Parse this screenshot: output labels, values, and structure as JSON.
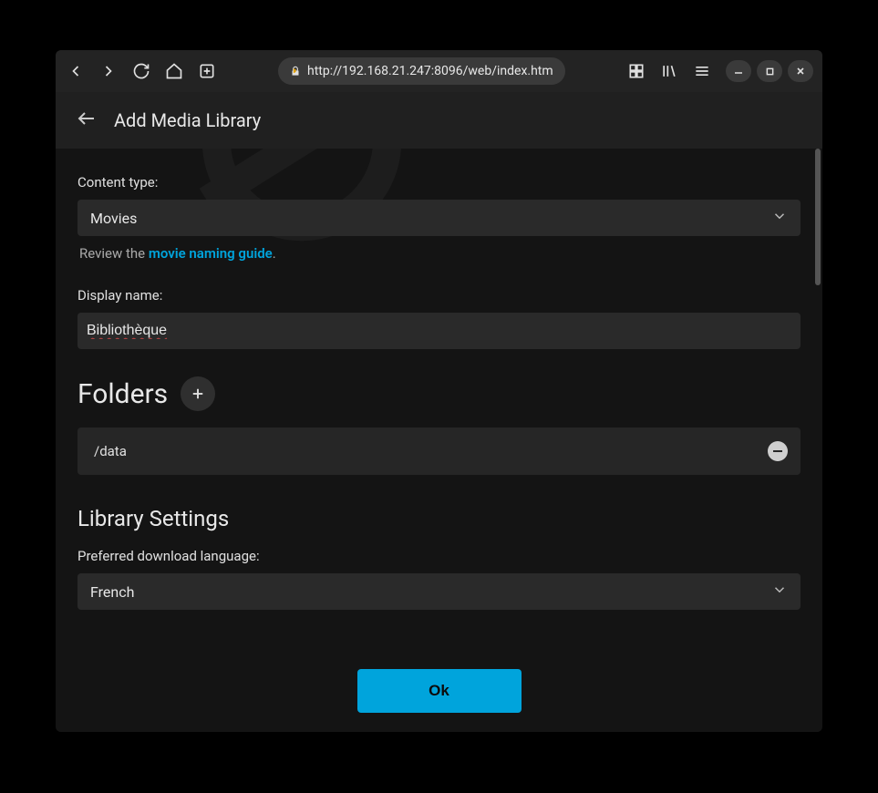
{
  "browser": {
    "url": "http://192.168.21.247:8096/web/index.htm"
  },
  "header": {
    "title": "Add Media Library"
  },
  "form": {
    "content_type_label": "Content type:",
    "content_type_value": "Movies",
    "hint_prefix": "Review the ",
    "hint_link": "movie naming guide",
    "hint_suffix": ".",
    "display_name_label": "Display name:",
    "display_name_value": "Bibliothèque"
  },
  "folders": {
    "title": "Folders",
    "items": [
      {
        "path": "/data"
      }
    ]
  },
  "settings": {
    "title": "Library Settings",
    "language_label": "Preferred download language:",
    "language_value": "French"
  },
  "footer": {
    "ok": "Ok"
  }
}
